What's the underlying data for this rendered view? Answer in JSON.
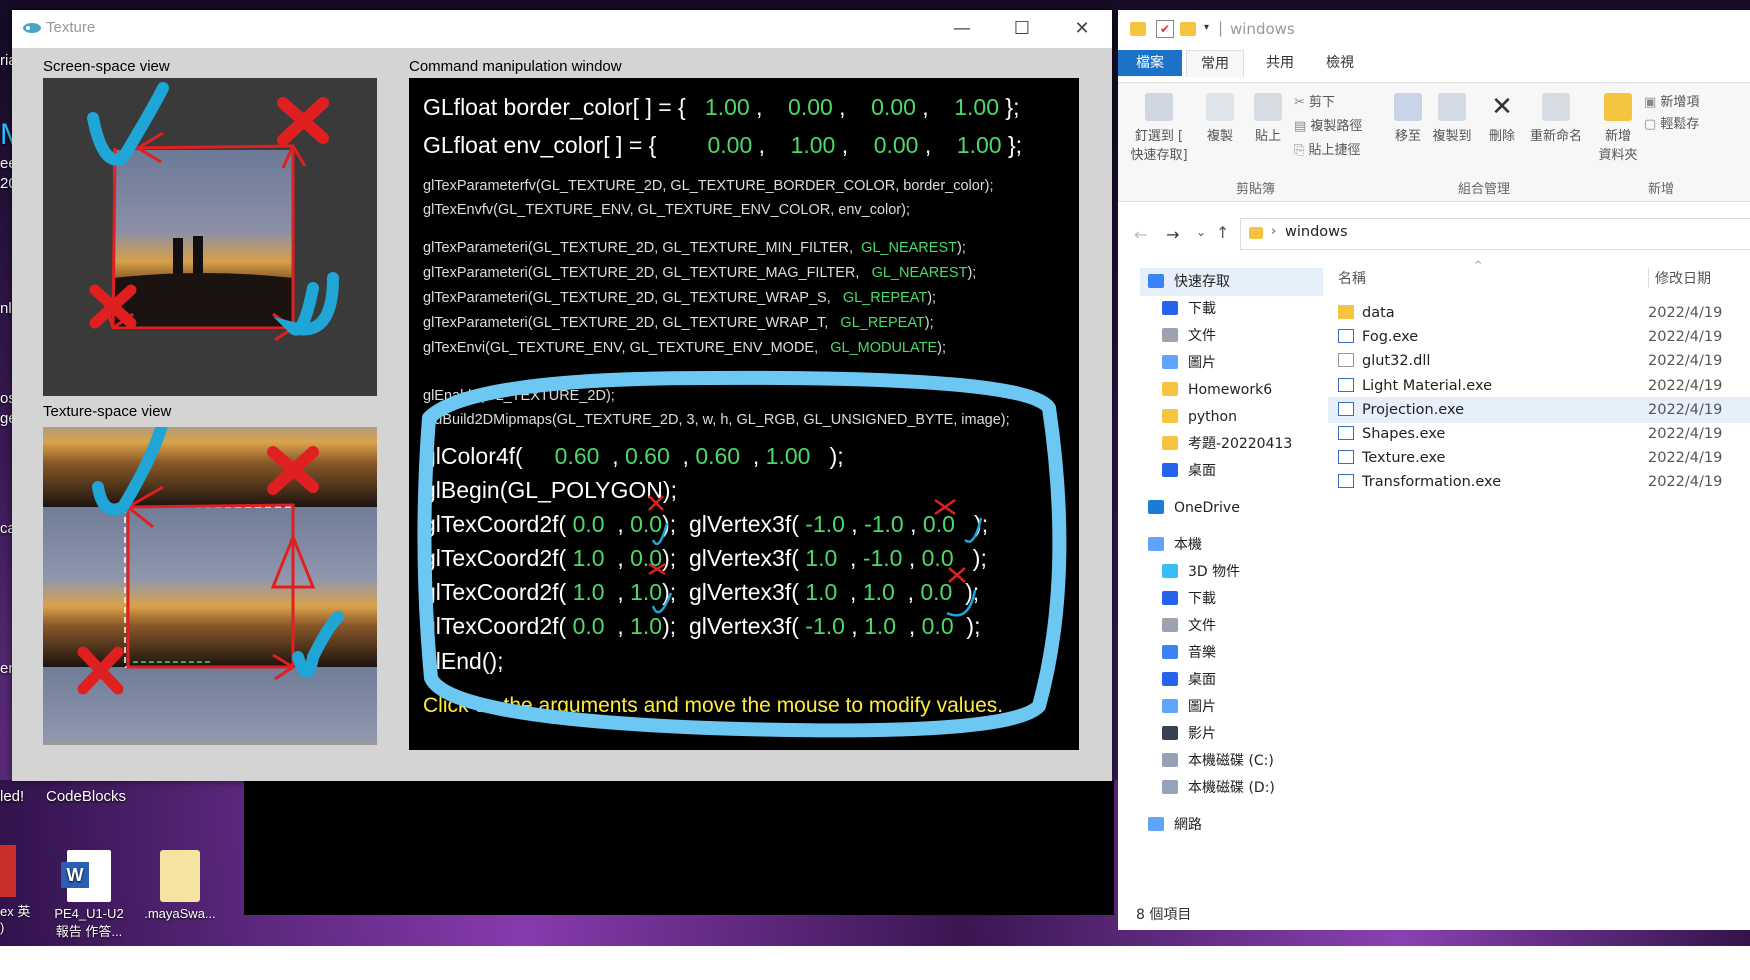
{
  "desktop": {
    "left_texts": [
      "ria",
      "M",
      "ee",
      "20",
      "nl",
      "J",
      "ose",
      "ge",
      "cam",
      "ent",
      "led!"
    ],
    "codeblocks_label": "CodeBlocks",
    "icons": [
      {
        "label": "ex 英\n)"
      },
      {
        "label": "PE4_U1-U2\n報告 作答..."
      },
      {
        "label": ".mayaSwa..."
      }
    ]
  },
  "texture_window": {
    "title": "Texture",
    "controls": {
      "minimize": "—",
      "maximize": "☐",
      "close": "✕"
    },
    "screen_space_label": "Screen-space view",
    "texture_space_label": "Texture-space view",
    "command_label": "Command manipulation window",
    "border_color": {
      "prefix": "GLfloat border_color[ ] = {",
      "v1": "1.00",
      "v2": "0.00",
      "v3": "0.00",
      "v4": "1.00"
    },
    "env_color": {
      "prefix": "GLfloat env_color[ ] = {",
      "v1": "0.00",
      "v2": "1.00",
      "v3": "0.00",
      "v4": "1.00"
    },
    "param_lines": [
      "glTexParameterfv(GL_TEXTURE_2D, GL_TEXTURE_BORDER_COLOR, border_color);",
      "glTexEnvfv(GL_TEXTURE_ENV, GL_TEXTURE_ENV_COLOR, env_color);"
    ],
    "filter_lines": [
      {
        "code": "glTexParameteri(GL_TEXTURE_2D, GL_TEXTURE_MIN_FILTER,",
        "arg": "GL_NEAREST"
      },
      {
        "code": "glTexParameteri(GL_TEXTURE_2D, GL_TEXTURE_MAG_FILTER,",
        "arg": "GL_NEAREST"
      },
      {
        "code": "glTexParameteri(GL_TEXTURE_2D, GL_TEXTURE_WRAP_S,",
        "arg": "GL_REPEAT"
      },
      {
        "code": "glTexParameteri(GL_TEXTURE_2D, GL_TEXTURE_WRAP_T,",
        "arg": "GL_REPEAT"
      },
      {
        "code": "glTexEnvi(GL_TEXTURE_ENV, GL_TEXTURE_ENV_MODE,",
        "arg": "GL_MODULATE"
      }
    ],
    "enable_line": "glEnable(GL_TEXTURE_2D);",
    "mipmap_line": "gluBuild2DMipmaps(GL_TEXTURE_2D, 3, w, h, GL_RGB, GL_UNSIGNED_BYTE, image);",
    "color4f": {
      "fn": "glColor4f(",
      "v1": "0.60",
      "v2": "0.60",
      "v3": "0.60",
      "v4": "1.00"
    },
    "begin": "glBegin(GL_POLYGON);",
    "vertices": [
      {
        "s": "0.0",
        "t": "0.0",
        "x": "-1.0",
        "y": "-1.0",
        "z": "0.0"
      },
      {
        "s": "1.0",
        "t": "0.0",
        "x": "1.0",
        "y": "-1.0",
        "z": "0.0"
      },
      {
        "s": "1.0",
        "t": "1.0",
        "x": "1.0",
        "y": "1.0",
        "z": "0.0"
      },
      {
        "s": "0.0",
        "t": "1.0",
        "x": "-1.0",
        "y": "1.0",
        "z": "0.0"
      }
    ],
    "end": "glEnd();",
    "hint": "Click on the arguments and move the mouse to modify values."
  },
  "explorer": {
    "title": "windows",
    "tabs": [
      "檔案",
      "常用",
      "共用",
      "檢視"
    ],
    "ribbon": {
      "pin": "釘選到 [\n快速存取]",
      "copy": "複製",
      "paste": "貼上",
      "cut": "剪下",
      "copy_path": "複製路徑",
      "paste_shortcut": "貼上捷徑",
      "move_to": "移至",
      "copy_to": "複製到",
      "delete": "刪除",
      "rename": "重新命名",
      "new_folder": "新增\n資料夾",
      "new_item": "新增項",
      "easy_access": "輕鬆存",
      "group_clipboard": "剪貼簿",
      "group_organize": "組合管理",
      "group_new": "新增"
    },
    "address": {
      "path": "windows"
    },
    "columns": {
      "name": "名稱",
      "date": "修改日期"
    },
    "nav": [
      {
        "label": "快速存取",
        "level": 0,
        "color": "#3b82f6"
      },
      {
        "label": "下載",
        "level": 1,
        "color": "#2563eb"
      },
      {
        "label": "文件",
        "level": 1,
        "color": "#9ca3af"
      },
      {
        "label": "圖片",
        "level": 1,
        "color": "#60a5fa"
      },
      {
        "label": "Homework6",
        "level": 1,
        "color": "#f5c542"
      },
      {
        "label": "python",
        "level": 1,
        "color": "#f5c542"
      },
      {
        "label": "考題-20220413",
        "level": 1,
        "color": "#f5c542"
      },
      {
        "label": "桌面",
        "level": 1,
        "color": "#2563eb"
      },
      {
        "label": "OneDrive",
        "level": 0,
        "color": "#1d7bd8"
      },
      {
        "label": "本機",
        "level": 0,
        "color": "#60a5fa"
      },
      {
        "label": "3D 物件",
        "level": 1,
        "color": "#38bdf8"
      },
      {
        "label": "下載",
        "level": 1,
        "color": "#2563eb"
      },
      {
        "label": "文件",
        "level": 1,
        "color": "#9ca3af"
      },
      {
        "label": "音樂",
        "level": 1,
        "color": "#3b82f6"
      },
      {
        "label": "桌面",
        "level": 1,
        "color": "#2563eb"
      },
      {
        "label": "圖片",
        "level": 1,
        "color": "#60a5fa"
      },
      {
        "label": "影片",
        "level": 1,
        "color": "#374151"
      },
      {
        "label": "本機磁碟 (C:)",
        "level": 1,
        "color": "#94a3b8"
      },
      {
        "label": "本機磁碟 (D:)",
        "level": 1,
        "color": "#94a3b8"
      },
      {
        "label": "網路",
        "level": 0,
        "color": "#60a5fa"
      }
    ],
    "files": [
      {
        "name": "data",
        "date": "2022/4/19",
        "type": "folder"
      },
      {
        "name": "Fog.exe",
        "date": "2022/4/19",
        "type": "exe"
      },
      {
        "name": "glut32.dll",
        "date": "2022/4/19",
        "type": "dll"
      },
      {
        "name": "Light Material.exe",
        "date": "2022/4/19",
        "type": "exe"
      },
      {
        "name": "Projection.exe",
        "date": "2022/4/19",
        "type": "exe"
      },
      {
        "name": "Shapes.exe",
        "date": "2022/4/19",
        "type": "exe"
      },
      {
        "name": "Texture.exe",
        "date": "2022/4/19",
        "type": "exe"
      },
      {
        "name": "Transformation.exe",
        "date": "2022/4/19",
        "type": "exe"
      }
    ],
    "selected_file": "Projection.exe",
    "status": "8 個項目"
  }
}
